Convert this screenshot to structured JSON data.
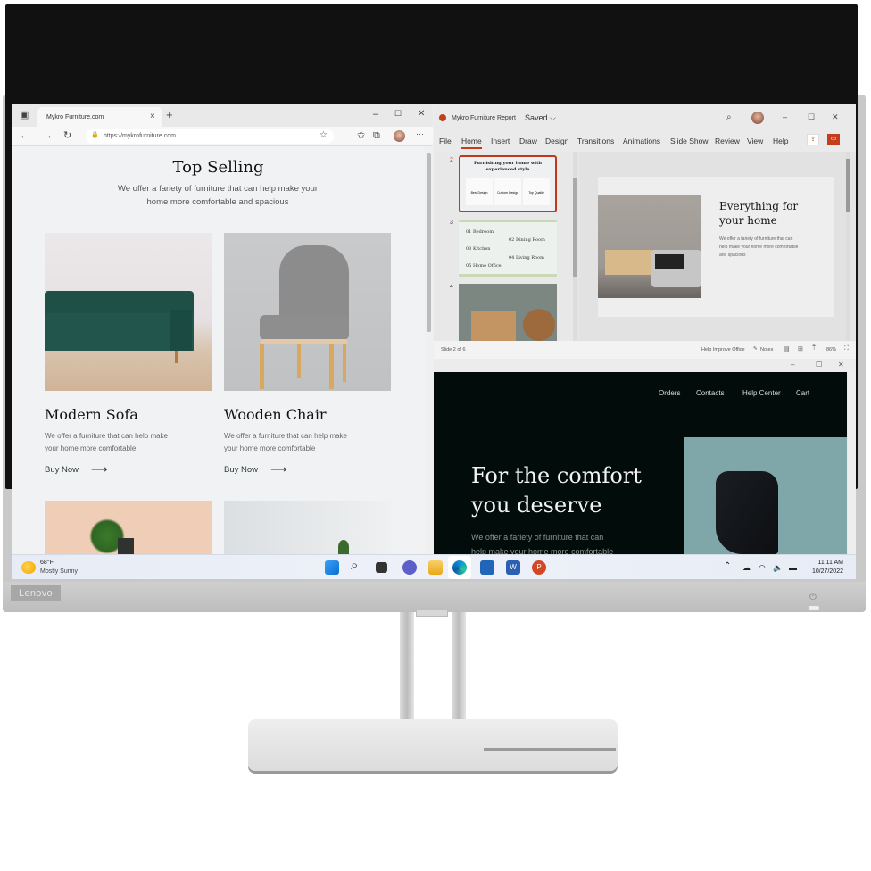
{
  "monitor": {
    "brand": "Lenovo",
    "power_icon": "⏻"
  },
  "browser": {
    "tab_title": "Mykro Furniture.com",
    "url": "https://mykrofurniture.com",
    "page": {
      "heading": "Top Selling",
      "subheading_line1": "We offer a fariety of furniture that can help make your",
      "subheading_line2": "home more comfortable and spacious",
      "products": [
        {
          "title": "Modern Sofa",
          "desc_line1": "We offer a furniture that can help make",
          "desc_line2": "your home more comfortable",
          "cta": "Buy Now"
        },
        {
          "title": "Wooden Chair",
          "desc_line1": "We offer a furniture that can help make",
          "desc_line2": "your home more comfortable",
          "cta": "Buy Now"
        }
      ]
    },
    "icons": {
      "tabs": "▣",
      "close": "×",
      "new_tab": "+",
      "minimize": "–",
      "maximize": "☐",
      "window_close": "✕",
      "back": "←",
      "forward": "→",
      "refresh": "↻",
      "lock": "🔒",
      "favorite": "☆",
      "favorites": "✩",
      "collections": "⧉",
      "more": "···"
    }
  },
  "powerpoint": {
    "doc_title": "Mykro Furniture Report",
    "save_state": "Saved ⌵",
    "menu": [
      "File",
      "Home",
      "Insert",
      "Draw",
      "Design",
      "Transitions",
      "Animations",
      "Slide Show",
      "Review",
      "View",
      "Help"
    ],
    "active_menu": "Home",
    "thumbnails": [
      {
        "number": "2",
        "title_line1": "Furnishing your home with",
        "title_line2": "experienced style",
        "cols": [
          "Best Design",
          "Custom Design",
          "Top Quality"
        ]
      },
      {
        "number": "3",
        "items": [
          "01  Bedroom",
          "02  Dining Room",
          "03  Kitchen",
          "04  Living Room",
          "05  Home Office"
        ]
      },
      {
        "number": "4"
      }
    ],
    "slide": {
      "title_line1": "Everything for",
      "title_line2": "your home",
      "body_line1": "We offer a fariety of furniture that can",
      "body_line2": "help make your home more comfortable",
      "body_line3": "and spacious"
    },
    "status": {
      "slide_counter": "Slide 2 of 6",
      "help": "Help Improve Office",
      "notes": "Notes",
      "zoom": "86%"
    }
  },
  "website2": {
    "nav": [
      "Orders",
      "Contacts",
      "Help Center",
      "Cart"
    ],
    "hero_line1": "For the comfort",
    "hero_line2": "you deserve",
    "body_line1": "We offer a fariety of furniture that can",
    "body_line2": "help make your home more comfortable"
  },
  "taskbar": {
    "weather_temp": "68°F",
    "weather_desc": "Mostly Sunny",
    "apps": [
      "Start",
      "Search",
      "Task View",
      "Teams",
      "File Explorer",
      "Edge",
      "Store",
      "Word",
      "PowerPoint"
    ],
    "time": "11:11 AM",
    "date": "10/27/2022",
    "tray_chevron": "⌃"
  }
}
